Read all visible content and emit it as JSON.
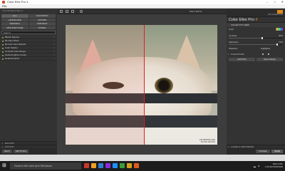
{
  "window": {
    "title": "Color Efex Pro 4",
    "menu": "File",
    "controls": [
      "–",
      "□",
      "✕"
    ]
  },
  "left": {
    "app_name": "COLOR EFEX PRO 4",
    "categories": [
      "ALL",
      "FAVORITES",
      "LANDSCAPE",
      "NATURE",
      "WEDDING",
      "PORTRAIT",
      "ARCHITECTURE",
      "TRAVEL"
    ],
    "search_placeholder": "Search",
    "filters": [
      "Bleach Bypass",
      "Bi-Color Filters",
      "Bi-Color User Defined",
      "Color Stylizer",
      "Contrast Color Range",
      "Darken/Lighten Center",
      "Detail Extractor"
    ],
    "sections": [
      "RECIPES",
      "HISTORY"
    ],
    "buttons": {
      "help": "HELP",
      "settings": "SETTINGS"
    }
  },
  "toolbar": {
    "zoom": "Zoom 100 %"
  },
  "photo": {
    "caption_line1": "CAT BEHIND GATE",
    "caption_line2": "ISO 200 1/60 f/5.6"
  },
  "right": {
    "brand": "NIK COLLECTION",
    "title": "Color Efex Pro",
    "version": "4",
    "section": "COLOR STYLIZER",
    "color_label": "Color",
    "contrast_label": "Contrast",
    "contrast_value": "40%",
    "saturation_label": "Saturation",
    "saturation_value": "72%",
    "shadows_label": "Shadows",
    "highlights_label": "Highlights",
    "control_points_label": "Control Points",
    "add_filter": "Add Filter",
    "save_recipe": "Save Recipe",
    "loupe_section": "LOUPE & HISTOGRAM",
    "cancel": "CANCEL",
    "save": "SAVE",
    "contrast_level": 0.62,
    "saturation_level": 0.9
  },
  "taskbar": {
    "search_placeholder": "Search the web and Windows",
    "app_colors": [
      "#c8372d",
      "#f0a020",
      "#2d7fd3",
      "#8a2be2",
      "#1e90ff",
      "#3a9d3a",
      "#d4a017",
      "#e05a1a"
    ],
    "lang": "ENG INTL",
    "time": "1:25 AM",
    "date": "8/20/2016"
  }
}
